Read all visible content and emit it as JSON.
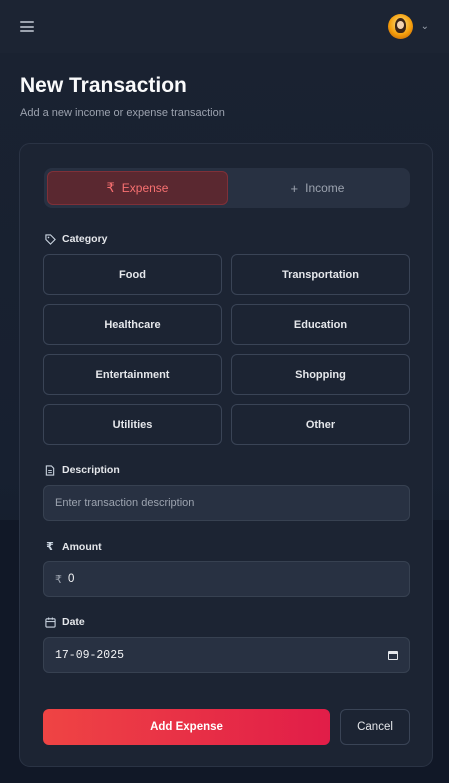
{
  "header": {
    "title": "New Transaction",
    "subtitle": "Add a new income or expense transaction"
  },
  "toggle": {
    "expense_label": "Expense",
    "income_label": "Income",
    "expense_icon": "₹",
    "income_icon": "+",
    "selected": "Expense"
  },
  "category": {
    "label": "Category",
    "items": [
      "Food",
      "Transportation",
      "Healthcare",
      "Education",
      "Entertainment",
      "Shopping",
      "Utilities",
      "Other"
    ]
  },
  "description": {
    "label": "Description",
    "placeholder": "Enter transaction description",
    "value": ""
  },
  "amount": {
    "label": "Amount",
    "prefix": "₹",
    "value": "0"
  },
  "date": {
    "label": "Date",
    "value": "17-09-2025"
  },
  "actions": {
    "submit_label": "Add Expense",
    "cancel_label": "Cancel"
  },
  "colors": {
    "accent": "#ef4444",
    "accent_end": "#e11d48",
    "card_bg": "#1c2433",
    "page_bg": "#111827"
  }
}
